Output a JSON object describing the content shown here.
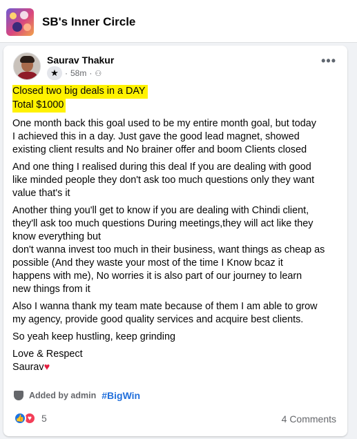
{
  "group": {
    "title": "SB's Inner Circle"
  },
  "post": {
    "author": "Saurav Thakur",
    "time": "58m",
    "highlight_lines": [
      "Closed two big deals in a DAY",
      "Total $1000"
    ],
    "paragraphs": [
      "One month back this goal used to be my entire month goal, but today\nI achieved this in a day. Just gave the good lead magnet, showed\nexisting client results and No brainer offer and boom Clients closed",
      "And one thing I realised during this deal If you are dealing with good\nlike minded people they don't ask too much questions only they want\nvalue that's it",
      "Another thing you'll get to know if you are dealing with Chindi client,\nthey'll ask too much questions During meetings,they will act like they\nknow everything but\ndon't wanna invest too much in their business, want things as cheap as\npossible (And they waste your most of the time I Know bcaz it\nhappens with me), No worries it is also part of our journey to learn\nnew things from it",
      "Also I wanna thank my team mate because of them I am able to grow\nmy agency, provide good quality services and acquire best clients.",
      "So yeah keep hustling, keep grinding"
    ],
    "signoff": "Love & Respect",
    "signature": "Saurav",
    "added_by": "Added by admin",
    "hashtag": "#BigWin",
    "reaction_count": "5",
    "comments": "4 Comments"
  },
  "icons": {
    "badge": "star-icon",
    "privacy": "globe-icon",
    "more": "more-dots-icon",
    "added": "shield-icon",
    "reactions": [
      "like-icon",
      "love-icon"
    ],
    "signature_heart": "heart-icon"
  },
  "colors": {
    "highlight": "#fff200",
    "hashtag": "#216fdb",
    "like": "#1b74e4",
    "love": "#f33e58",
    "heart": "#e41e3f"
  }
}
